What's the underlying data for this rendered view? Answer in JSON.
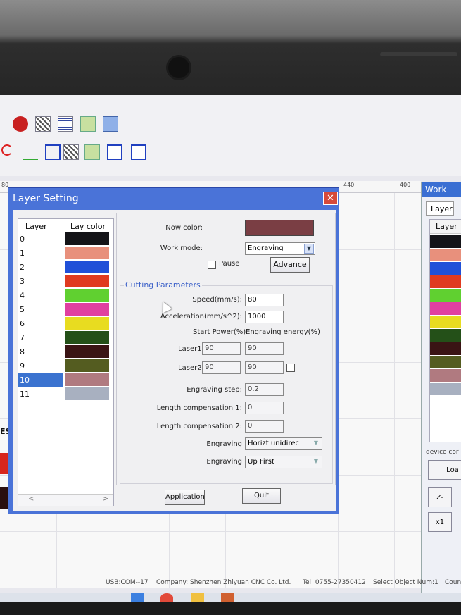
{
  "window": {
    "title": "Layer Setting"
  },
  "right_panel": {
    "title": "Work",
    "tab": "Layer",
    "list_header": "Layer",
    "device_label": "device cor",
    "load_button": "Loa",
    "z_button": "Z-",
    "x1_button": "x1"
  },
  "ruler": {
    "ticks": [
      "80",
      "",
      "",
      "",
      "",
      "440",
      "400"
    ]
  },
  "canvas": {
    "left_text": "ES"
  },
  "layer_list": {
    "header_layer": "Layer",
    "header_color": "Lay color",
    "rows": [
      {
        "num": "0",
        "color": "#141418"
      },
      {
        "num": "1",
        "color": "#e8907c"
      },
      {
        "num": "2",
        "color": "#2050d8"
      },
      {
        "num": "3",
        "color": "#e03a20"
      },
      {
        "num": "4",
        "color": "#60d030"
      },
      {
        "num": "5",
        "color": "#e040a0"
      },
      {
        "num": "6",
        "color": "#e8dc20"
      },
      {
        "num": "7",
        "color": "#245018"
      },
      {
        "num": "8",
        "color": "#3a1414"
      },
      {
        "num": "9",
        "color": "#545c20"
      },
      {
        "num": "10",
        "color": "#b07a80"
      },
      {
        "num": "11",
        "color": "#a8b0c0"
      }
    ],
    "selected_index": 10,
    "scroll_left": "<",
    "scroll_right": ">"
  },
  "settings": {
    "now_color_label": "Now color:",
    "now_color_value": "#7a3e44",
    "work_mode_label": "Work mode:",
    "work_mode_value": "Engraving",
    "pause_label": "Pause",
    "advance_button": "Advance",
    "cutting_parameters_legend": "Cutting Parameters",
    "speed_label": "Speed(mm/s):",
    "speed_value": "80",
    "accel_label": "Acceleration(mm/s^2):",
    "accel_value": "1000",
    "start_power_label": "Start Power(%)",
    "engraving_energy_label": "Engraving energy(%)",
    "laser1_label": "Laser1:",
    "laser1_start": "90",
    "laser1_energy": "90",
    "laser2_label": "Laser2:",
    "laser2_start": "90",
    "laser2_energy": "90",
    "engraving_step_label": "Engraving step:",
    "engraving_step_value": "0.2",
    "length_comp1_label": "Length compensation 1:",
    "length_comp1_value": "0",
    "length_comp2_label": "Length compensation 2:",
    "length_comp2_value": "0",
    "engraving_label_1": "Engraving",
    "engraving_value_1": "Horizt unidirec",
    "engraving_label_2": "Engraving",
    "engraving_value_2": "Up First",
    "application_button": "Application",
    "quit_button": "Quit"
  },
  "status_bar": {
    "port": "USB:COM--17",
    "company": "Company: Shenzhen Zhiyuan CNC Co. Ltd.",
    "tel": "Tel: 0755-27350412",
    "select": "Select Object Num:1",
    "count": "Coun"
  }
}
